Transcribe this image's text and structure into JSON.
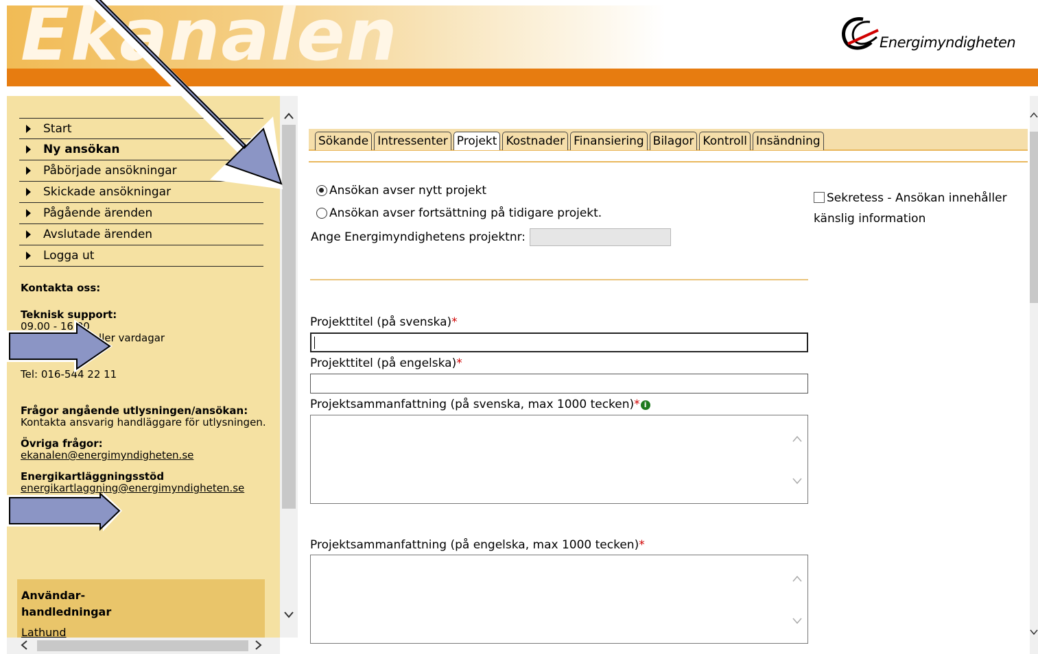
{
  "header": {
    "banner_text": "Ekanalen",
    "logo_text": "Energimyndigheten"
  },
  "nav": [
    {
      "label": "Start",
      "bold": false
    },
    {
      "label": "Ny ansökan",
      "bold": true
    },
    {
      "label": "Påbörjade ansökningar",
      "bold": false
    },
    {
      "label": "Skickade ansökningar",
      "bold": false
    },
    {
      "label": "Pågående ärenden",
      "bold": false
    },
    {
      "label": "Avslutade ärenden",
      "bold": false
    },
    {
      "label": "Logga ut",
      "bold": false
    }
  ],
  "contact": {
    "heading": "Kontakta oss:",
    "tech_heading": "Teknisk support:",
    "hours": "09.00 - 16.00",
    "hours_note_1": "(ej helgdagar eller vardagar",
    "hours_note_2": "före helgdagar)",
    "phone": "Tel: 016-544 22 11",
    "questions_heading": "Frågor angående utlysningen/ansökan:",
    "questions_text": "Kontakta ansvarig handläggare för utlysningen.",
    "other_heading": "Övriga frågor:",
    "other_email": "ekanalen@energimyndigheten.se",
    "mapping_heading": "Energikartläggningsstöd",
    "mapping_email": "energikartlaggning@energimyndigheten.se"
  },
  "manuals": {
    "title_1": "Användar-",
    "title_2": "handledningar",
    "link": "Lathund"
  },
  "tabs": [
    {
      "label": "Sökande",
      "active": false
    },
    {
      "label": "Intressenter",
      "active": false
    },
    {
      "label": "Projekt",
      "active": true
    },
    {
      "label": "Kostnader",
      "active": false
    },
    {
      "label": "Finansiering",
      "active": false
    },
    {
      "label": "Bilagor",
      "active": false
    },
    {
      "label": "Kontroll",
      "active": false
    },
    {
      "label": "Insändning",
      "active": false
    }
  ],
  "form": {
    "radio_new": "Ansökan avser nytt projekt",
    "radio_new_checked": true,
    "radio_continuation": "Ansökan avser fortsättning på tidigare projekt.",
    "radio_continuation_checked": false,
    "projnr_label": "Ange Energimyndighetens projektnr:",
    "projnr_value": "",
    "secrecy_label": "Sekretess - Ansökan innehåller känslig information",
    "secrecy_checked": false,
    "title_sv_label": "Projekttitel (på svenska)",
    "title_sv_value": "",
    "title_en_label": "Projekttitel (på engelska)",
    "title_en_value": "",
    "summary_sv_label": "Projektsammanfattning (på svenska, max 1000 tecken)",
    "summary_sv_value": "",
    "summary_en_label": "Projektsammanfattning (på engelska, max 1000 tecken)",
    "summary_en_value": "",
    "required_mark": "*",
    "info_icon_glyph": "i"
  },
  "colors": {
    "orange_bar": "#e77c10",
    "sidebar_bg": "#f5e1a2",
    "manuals_bg": "#e9c56a",
    "tab_strip": "#f5deaa",
    "arrow_fill": "#8b95c5",
    "required": "#d00000"
  },
  "icons": {
    "logo": "energimyndigheten-swoosh-icon",
    "info": "info-icon",
    "annotation": "arrow-icon"
  }
}
